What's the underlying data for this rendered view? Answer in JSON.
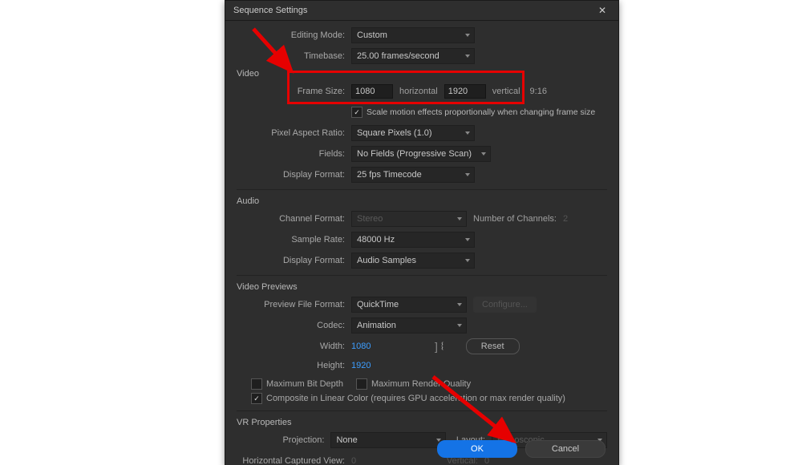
{
  "dialog": {
    "title": "Sequence Settings"
  },
  "editingMode": {
    "label": "Editing Mode:",
    "value": "Custom"
  },
  "timebase": {
    "label": "Timebase:",
    "value": "25.00  frames/second"
  },
  "sections": {
    "video": "Video",
    "audio": "Audio",
    "previews": "Video Previews",
    "vr": "VR Properties"
  },
  "frameSize": {
    "label": "Frame Size:",
    "h": "1080",
    "hLabel": "horizontal",
    "v": "1920",
    "vLabel": "vertical",
    "aspect": "9:16"
  },
  "scaleMotion": {
    "label": "Scale motion effects proportionally when changing frame size",
    "checked": true
  },
  "pixelAspect": {
    "label": "Pixel Aspect Ratio:",
    "value": "Square Pixels (1.0)"
  },
  "fields": {
    "label": "Fields:",
    "value": "No Fields (Progressive Scan)"
  },
  "dispFormatV": {
    "label": "Display Format:",
    "value": "25 fps Timecode"
  },
  "channelFormat": {
    "label": "Channel Format:",
    "value": "Stereo"
  },
  "numChannels": {
    "label": "Number of Channels:",
    "value": "2"
  },
  "sampleRate": {
    "label": "Sample Rate:",
    "value": "48000 Hz"
  },
  "dispFormatA": {
    "label": "Display Format:",
    "value": "Audio Samples"
  },
  "previewFile": {
    "label": "Preview File Format:",
    "value": "QuickTime",
    "configure": "Configure..."
  },
  "codec": {
    "label": "Codec:",
    "value": "Animation"
  },
  "pWidth": {
    "label": "Width:",
    "value": "1080"
  },
  "pHeight": {
    "label": "Height:",
    "value": "1920"
  },
  "reset": "Reset",
  "maxBitDepth": {
    "label": "Maximum Bit Depth",
    "checked": false
  },
  "maxRenderQ": {
    "label": "Maximum Render Quality",
    "checked": false
  },
  "compositeLinear": {
    "label": "Composite in Linear Color (requires GPU acceleration or max render quality)",
    "checked": true
  },
  "projection": {
    "label": "Projection:",
    "value": "None"
  },
  "layout": {
    "label": "Layout:",
    "value": "Monoscopic"
  },
  "hCapturedView": {
    "label": "Horizontal Captured View:",
    "value": "0"
  },
  "vCapturedView": {
    "label": "Vertical:",
    "value": "0"
  },
  "buttons": {
    "ok": "OK",
    "cancel": "Cancel"
  }
}
